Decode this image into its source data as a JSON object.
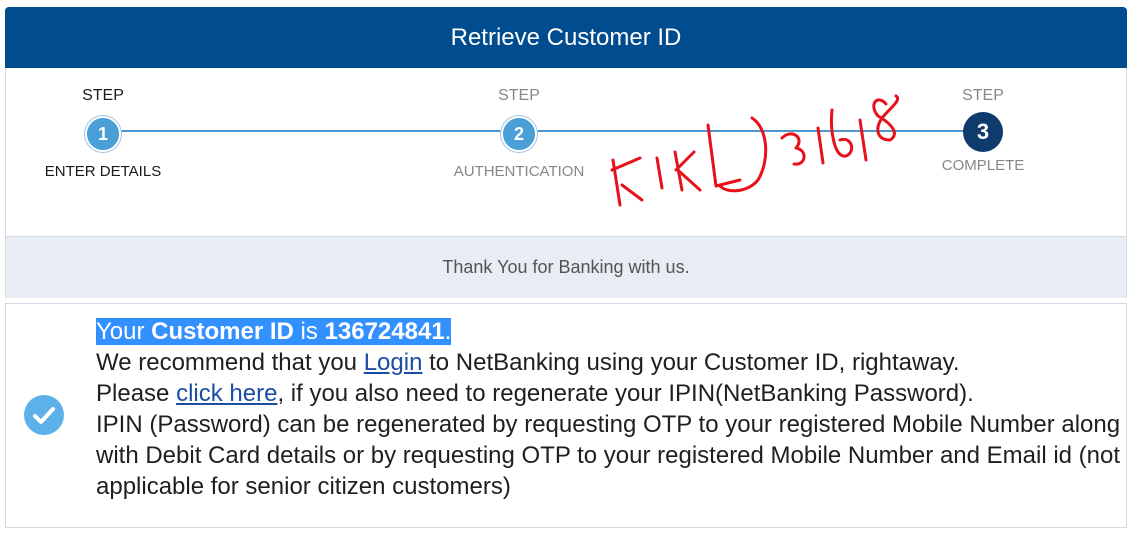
{
  "header": {
    "title": "Retrieve Customer ID"
  },
  "steps": [
    {
      "top_label": "STEP",
      "number": "1",
      "bottom_label": "ENTER DETAILS"
    },
    {
      "top_label": "STEP",
      "number": "2",
      "bottom_label": "AUTHENTICATION"
    },
    {
      "top_label": "STEP",
      "number": "3",
      "bottom_label": "COMPLETE"
    }
  ],
  "thanks_text": "Thank You for Banking with us.",
  "message": {
    "prefix": "Your ",
    "id_label": "Customer ID",
    "is_word": " is ",
    "customer_id": "136724841",
    "period": ".",
    "line2_pre": "We recommend that you ",
    "login_link": "Login",
    "line2_post": " to NetBanking using your Customer ID, rightaway.",
    "line3_pre": "Please ",
    "click_here_link": "click here",
    "line3_post": ", if you also need to regenerate your IPIN(NetBanking Password).",
    "line4": "IPIN (Password) can be regenerated by requesting OTP to your registered Mobile Number along with Debit Card details or by requesting OTP to your registered Mobile Number and Email id (not applicable for senior citizen customers)"
  },
  "icons": {
    "check": "check-circle-icon"
  },
  "colors": {
    "header_bg": "#004c8f",
    "step_blue": "#4a9fd6",
    "step_complete": "#0e3a6c",
    "highlight": "#3390ff",
    "annotation_red": "#e8101a"
  }
}
